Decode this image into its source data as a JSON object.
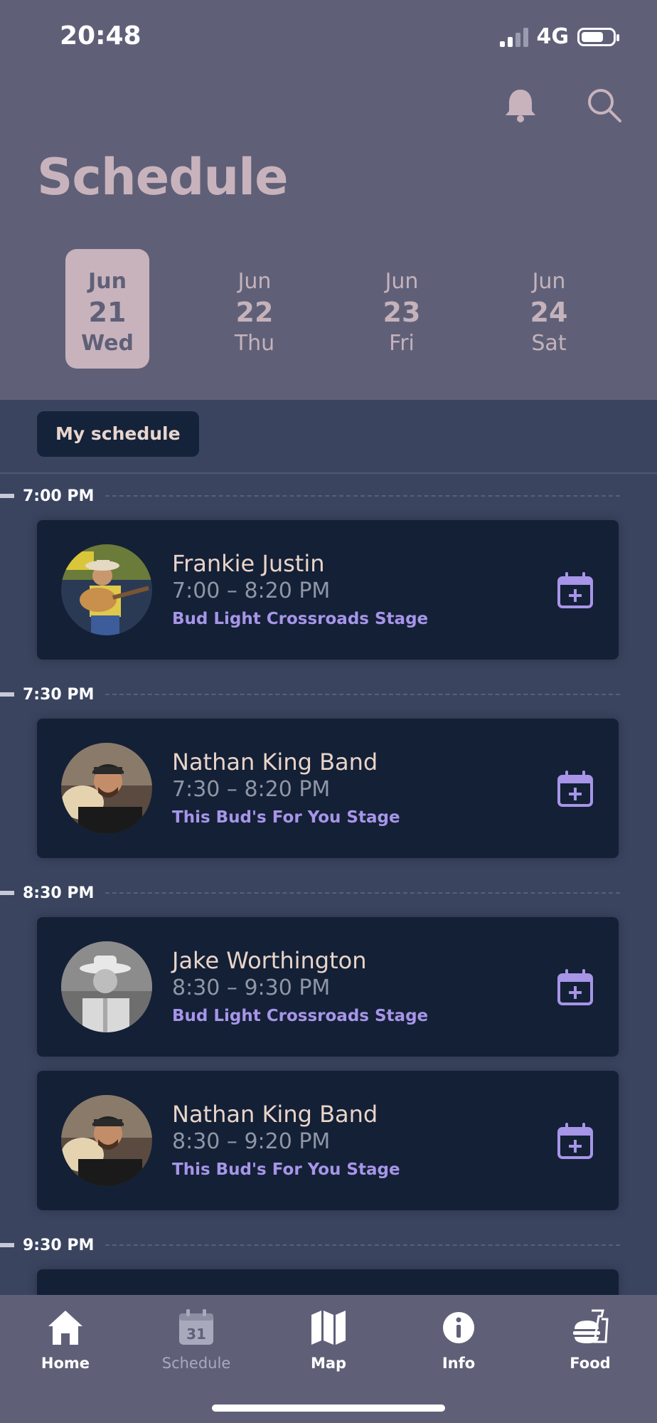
{
  "status_bar": {
    "time": "20:48",
    "network": "4G"
  },
  "header": {
    "title": "Schedule"
  },
  "days": [
    {
      "month": "Jun",
      "day": "21",
      "weekday": "Wed",
      "selected": true
    },
    {
      "month": "Jun",
      "day": "22",
      "weekday": "Thu",
      "selected": false
    },
    {
      "month": "Jun",
      "day": "23",
      "weekday": "Fri",
      "selected": false
    },
    {
      "month": "Jun",
      "day": "24",
      "weekday": "Sat",
      "selected": false
    }
  ],
  "filter": {
    "label": "My schedule"
  },
  "time_slots": [
    "7:00 PM",
    "7:30 PM",
    "8:30 PM",
    "9:30 PM"
  ],
  "events": [
    {
      "name": "Frankie Justin",
      "time": "7:00 – 8:20 PM",
      "stage": "Bud Light Crossroads Stage"
    },
    {
      "name": "Nathan King Band",
      "time": "7:30 – 8:20 PM",
      "stage": "This Bud's For You Stage"
    },
    {
      "name": "Jake Worthington",
      "time": "8:30 – 9:30 PM",
      "stage": "Bud Light Crossroads Stage"
    },
    {
      "name": "Nathan King Band",
      "time": "8:30 – 9:20 PM",
      "stage": "This Bud's For You Stage"
    }
  ],
  "tabbar": {
    "items": [
      {
        "label": "Home",
        "icon": "home-icon"
      },
      {
        "label": "Schedule",
        "icon": "calendar-icon",
        "calendar_number": "31"
      },
      {
        "label": "Map",
        "icon": "map-icon"
      },
      {
        "label": "Info",
        "icon": "info-icon"
      },
      {
        "label": "Food",
        "icon": "food-icon"
      }
    ]
  },
  "colors": {
    "header_bg": "#5f6078",
    "list_bg": "#3a445f",
    "card_bg": "#132036",
    "accent_purple": "#a795e8",
    "title_pink": "#c8b3bd"
  }
}
